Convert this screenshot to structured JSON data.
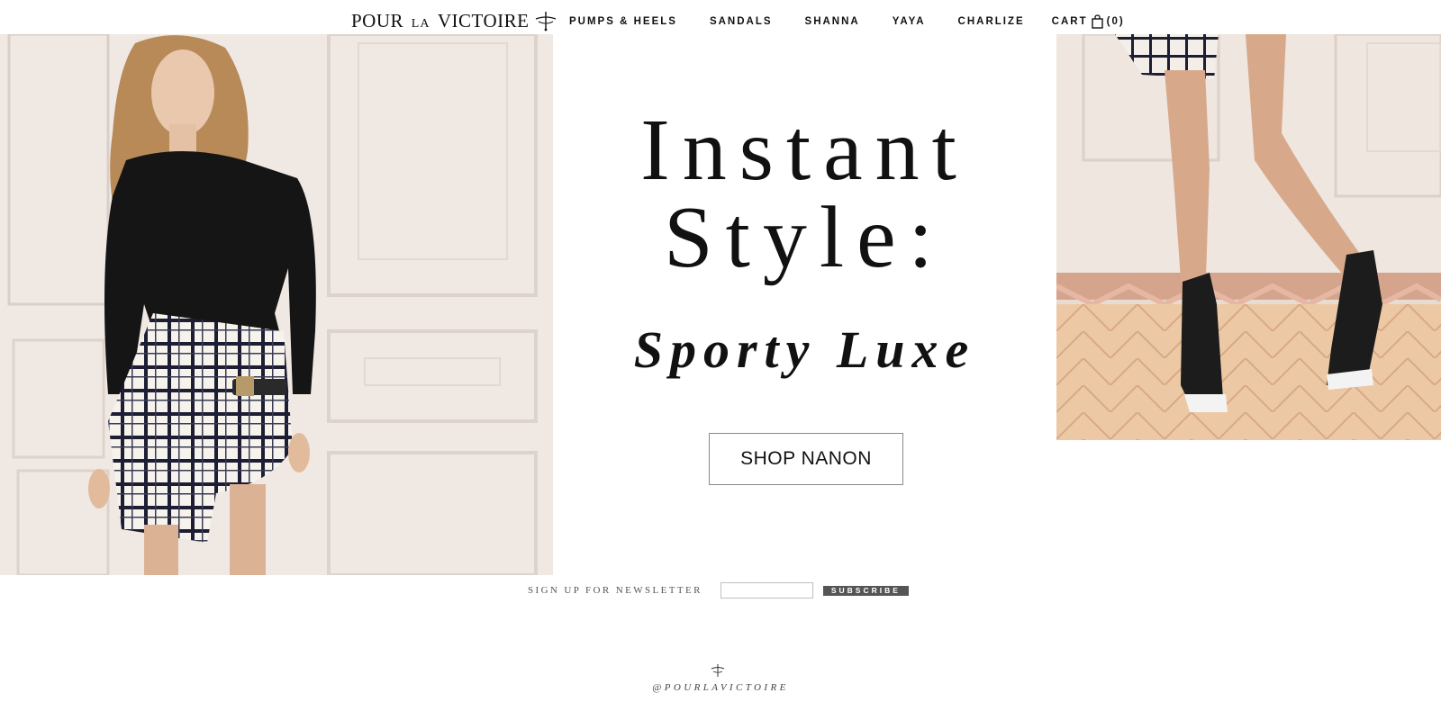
{
  "brand": {
    "logo_main": "POUR",
    "logo_small": "LA",
    "logo_end": "VICTOIRE"
  },
  "nav": {
    "items": [
      {
        "label": "PUMPS & HEELS"
      },
      {
        "label": "SANDALS"
      },
      {
        "label": "SHANNA"
      },
      {
        "label": "YAYA"
      },
      {
        "label": "CHARLIZE"
      }
    ],
    "cart_label": "CART",
    "cart_count": "(0)"
  },
  "hero": {
    "title_line1": "Instant",
    "title_line2": "Style:",
    "subtitle": "Sporty Luxe",
    "cta_label": "SHOP NANON"
  },
  "newsletter": {
    "label": "SIGN UP FOR NEWSLETTER",
    "input_value": "",
    "button_label": "SUBSCRIBE"
  },
  "footer": {
    "handle": "@POURLAVICTOIRE"
  },
  "colors": {
    "text": "#111111",
    "subscribe_bg": "#555555",
    "button_border": "#8a8a8a"
  },
  "icons": {
    "logo_mark": "sword-cross-icon",
    "cart": "shopping-bag-icon",
    "footer_mark": "sword-cross-icon"
  }
}
